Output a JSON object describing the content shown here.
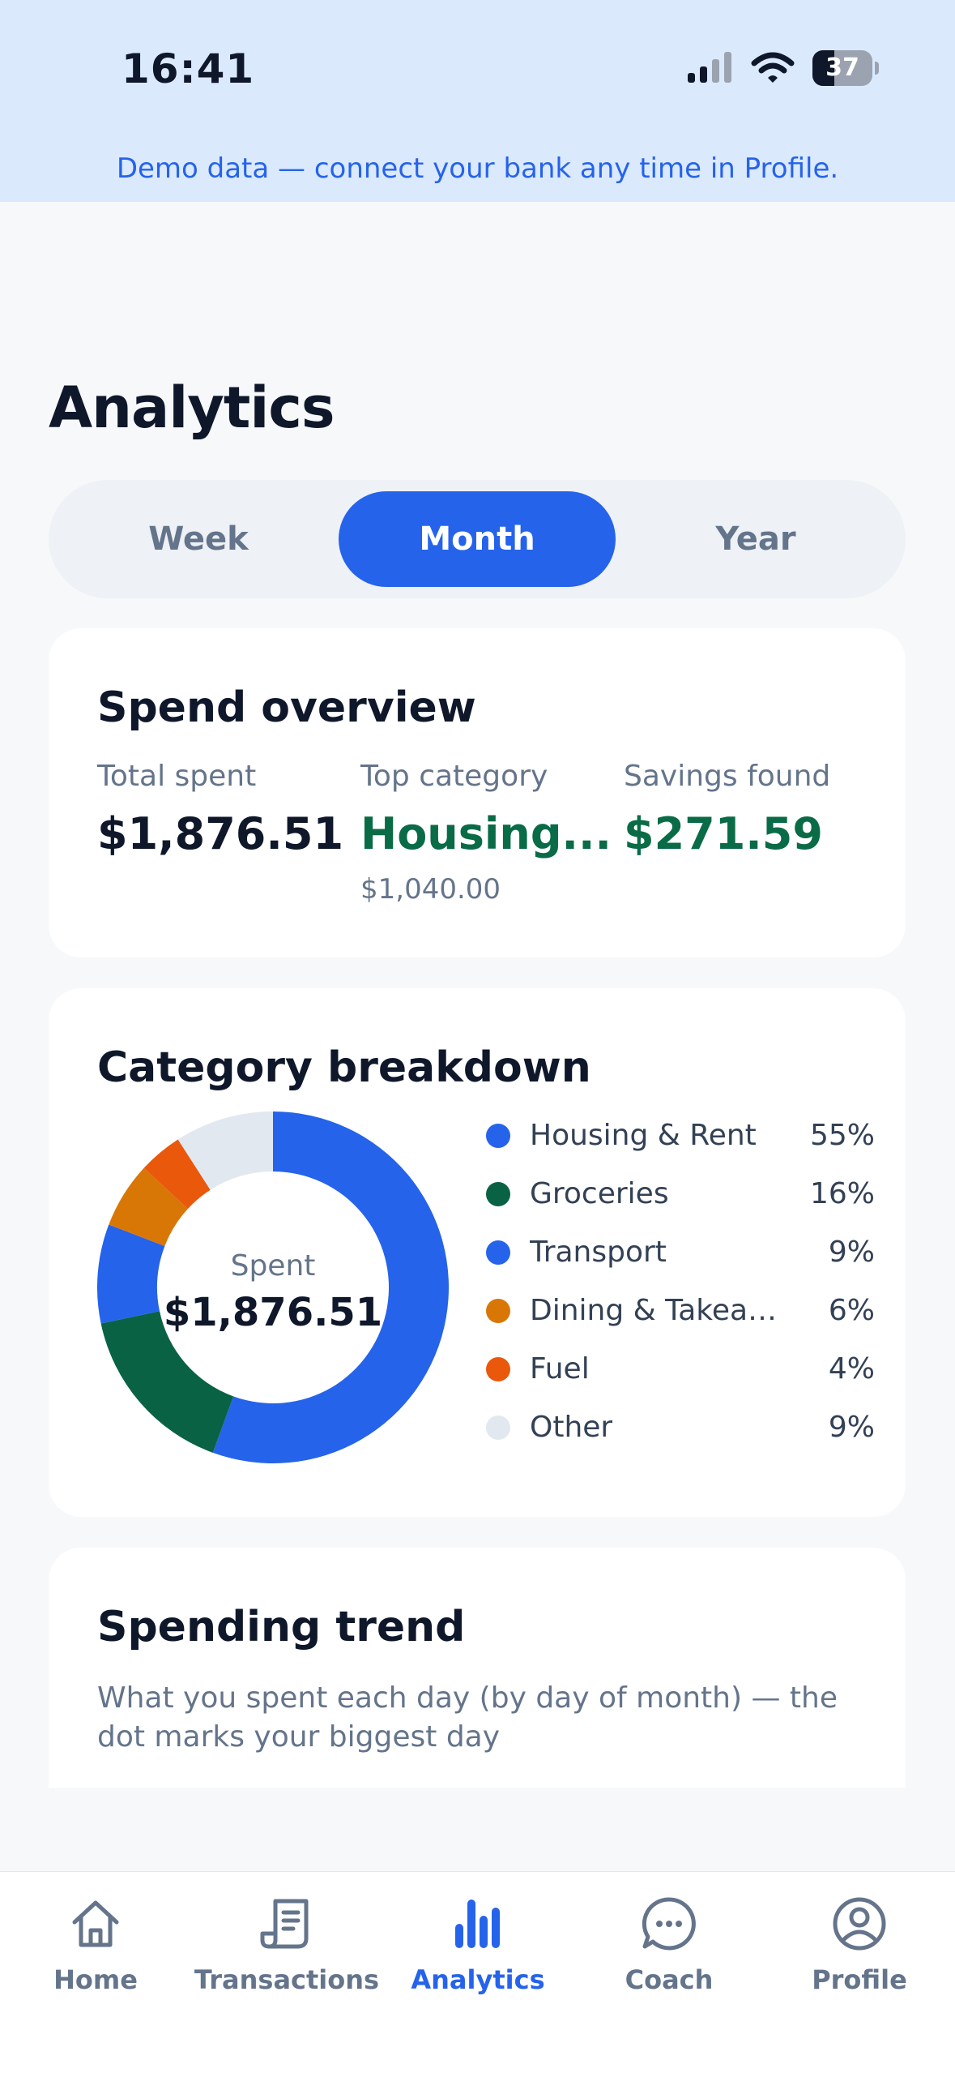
{
  "status_bar": {
    "time": "16:41",
    "battery": "37",
    "battery_level": 0.37
  },
  "banner": {
    "text": "Demo data — connect your bank any time in Profile."
  },
  "page": {
    "title": "Analytics"
  },
  "period_tabs": {
    "items": [
      "Week",
      "Month",
      "Year"
    ],
    "selected": "Month"
  },
  "overview": {
    "title": "Spend overview",
    "total": {
      "label": "Total spent",
      "value": "$1,876.51"
    },
    "top_category": {
      "label": "Top category",
      "value": "Housing...",
      "sub": "$1,040.00"
    },
    "savings": {
      "label": "Savings found",
      "value": "$271.59"
    }
  },
  "breakdown": {
    "title": "Category breakdown",
    "center_label": "Spent",
    "center_value": "$1,876.51",
    "items": [
      {
        "label": "Housing & Rent",
        "pct": "55%",
        "value": 55,
        "color": "#2563EB"
      },
      {
        "label": "Groceries",
        "pct": "16%",
        "value": 16,
        "color": "#0A6245"
      },
      {
        "label": "Transport",
        "pct": "9%",
        "value": 9,
        "color": "#2563EB"
      },
      {
        "label": "Dining & Takeaway",
        "pct": "6%",
        "value": 6,
        "color": "#D97706"
      },
      {
        "label": "Fuel",
        "pct": "4%",
        "value": 4,
        "color": "#EA580C"
      },
      {
        "label": "Other",
        "pct": "9%",
        "value": 9,
        "color": "#E2E8F0"
      }
    ]
  },
  "trend": {
    "title": "Spending trend",
    "description": "What you spent each day (by day of month) — the dot marks your biggest day"
  },
  "tabbar": {
    "items": [
      {
        "label": "Home",
        "icon": "home-icon"
      },
      {
        "label": "Transactions",
        "icon": "receipt-icon"
      },
      {
        "label": "Analytics",
        "icon": "bar-chart-icon"
      },
      {
        "label": "Coach",
        "icon": "chat-bubble-icon"
      },
      {
        "label": "Profile",
        "icon": "user-circle-icon"
      }
    ],
    "active": "Analytics"
  }
}
